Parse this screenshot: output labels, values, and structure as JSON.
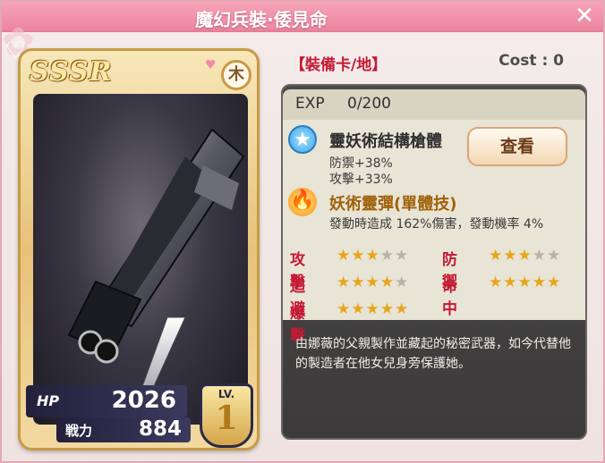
{
  "window": {
    "title": "魔幻兵裝·倭見命",
    "close": "✕"
  },
  "card": {
    "rarity": "SSSR",
    "element_badge": "木",
    "hp_label": "HP",
    "hp_value": "2026",
    "power_label": "戦力",
    "power_value": "884",
    "level_label": "LV.",
    "level_value": "1"
  },
  "info": {
    "card_type": "【裝備卡/地】",
    "cost": "Cost : 0",
    "exp_label": "EXP",
    "exp_value": "0/200",
    "skills": [
      {
        "name": "靈妖術結構槍體",
        "icon": "star-icon",
        "lines": [
          "防禦+38%",
          "攻擊+33%"
        ]
      },
      {
        "name": "妖術靈彈(單體技)",
        "icon": "fire-icon",
        "lines": [
          "發動時造成 162%傷害，發動機率 4%"
        ]
      }
    ],
    "view_button": "查看",
    "stats": [
      {
        "label": "攻擊",
        "stars": 3,
        "max": 5
      },
      {
        "label": "防禦",
        "stars": 3,
        "max": 5
      },
      {
        "label": "迴避",
        "stars": 4,
        "max": 5
      },
      {
        "label": "命中",
        "stars": 5,
        "max": 5
      },
      {
        "label": "爆擊",
        "stars": 5,
        "max": 5
      }
    ],
    "description": "由娜薇的父親製作並藏起的秘密武器，如今代替他的製造者在他女兒身旁保護她。"
  },
  "colors": {
    "title_bar": "#ec86a0",
    "accent_red": "#c41a35",
    "star_on": "#e8a51a",
    "panel_dark": "#3c3a3a"
  }
}
